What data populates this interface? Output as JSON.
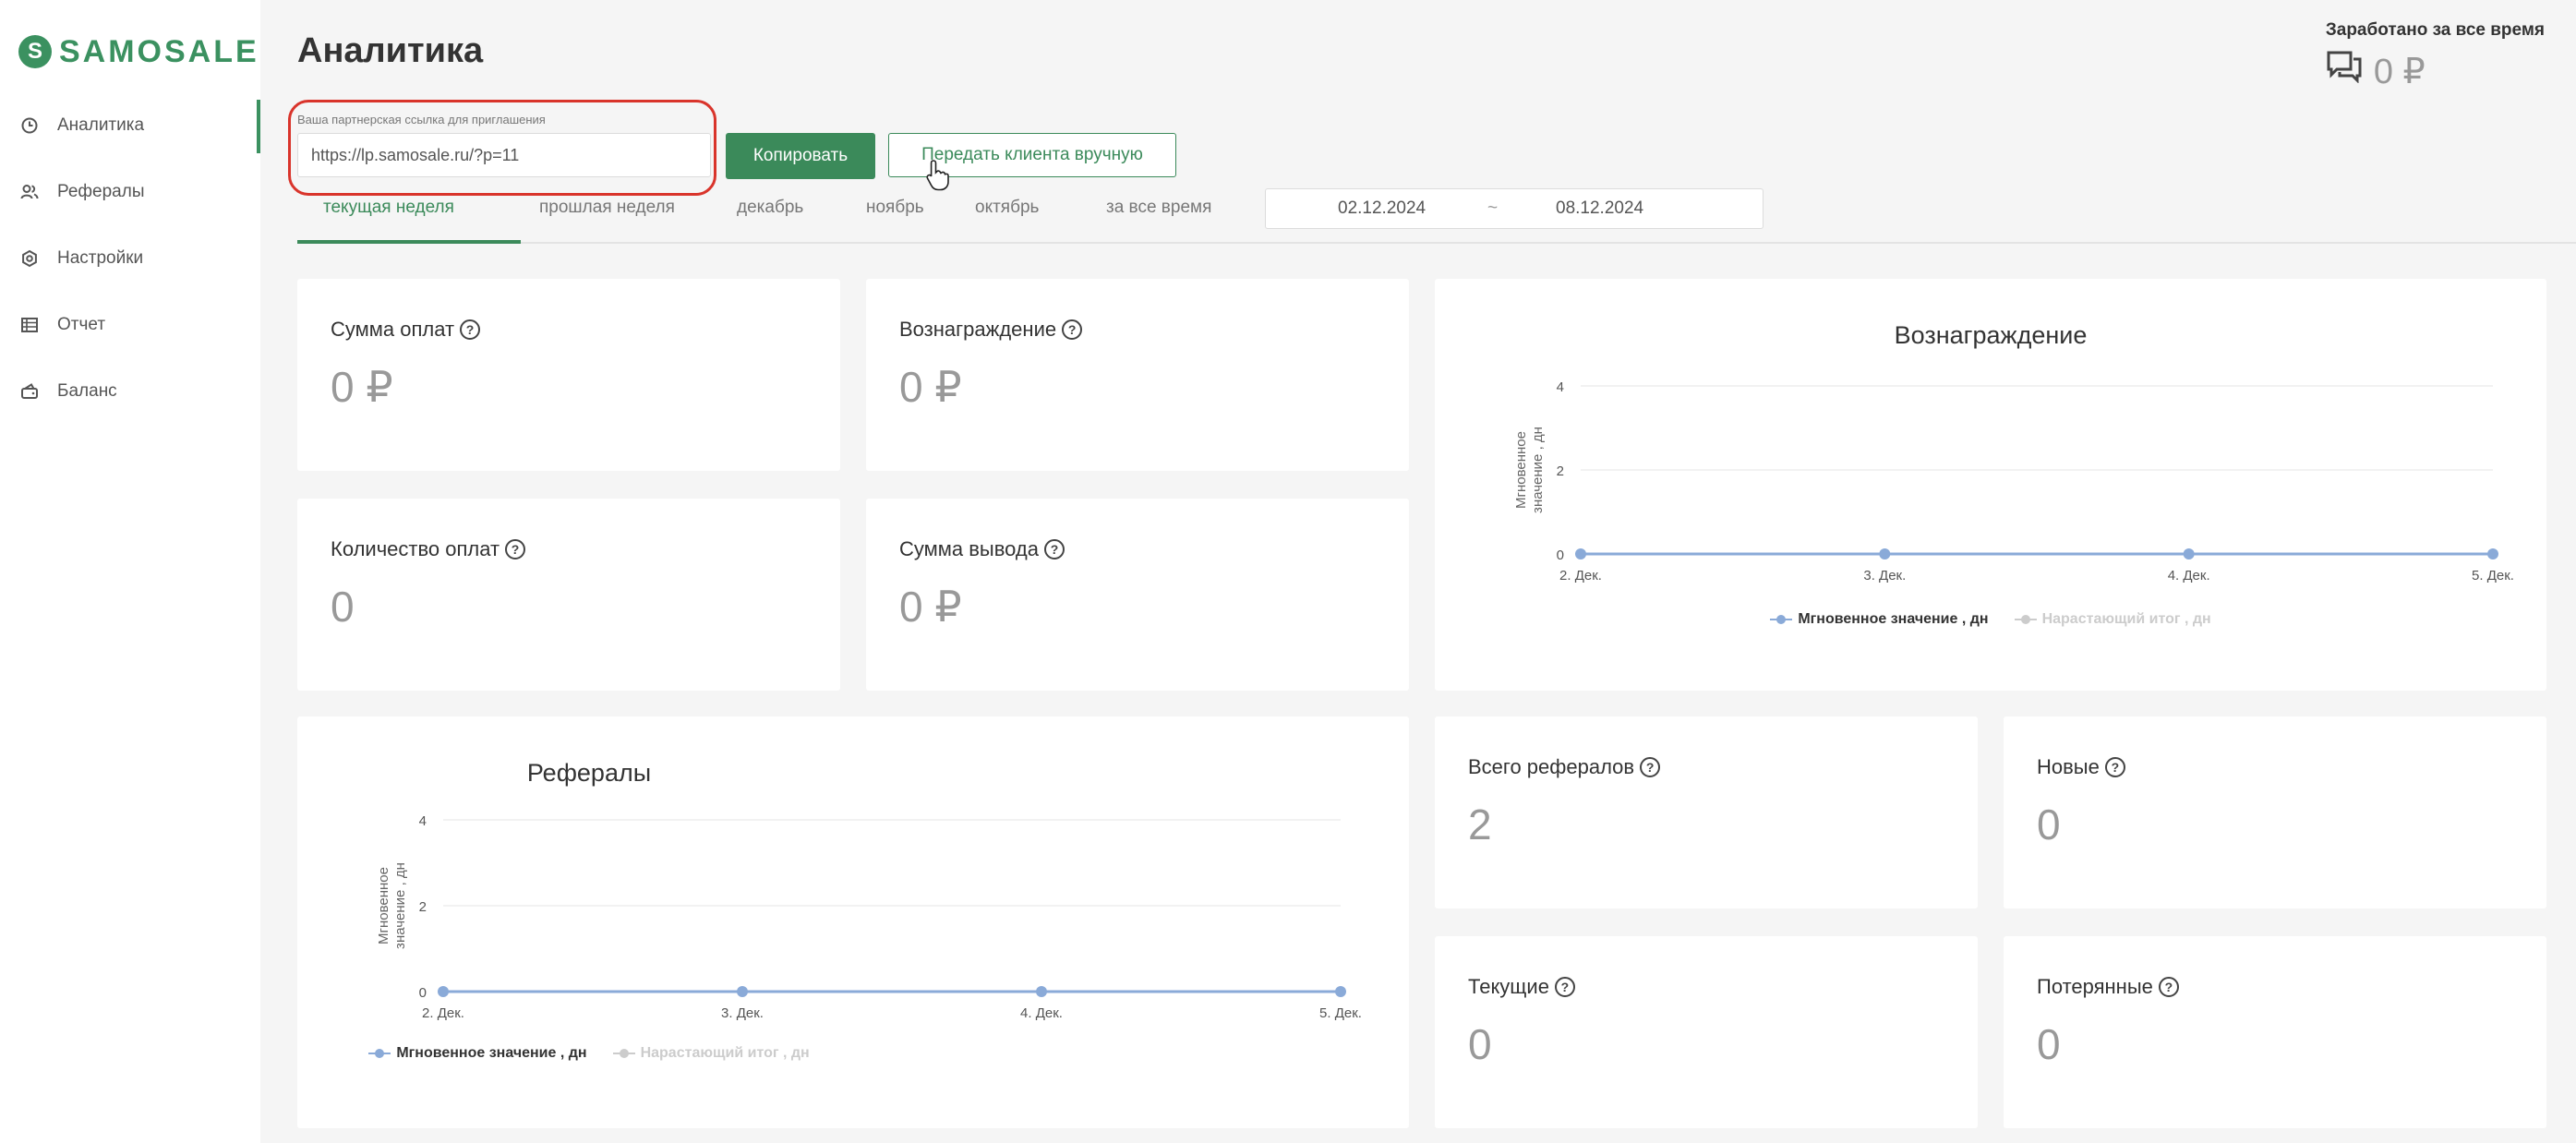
{
  "brand": {
    "logo_text": "SAMOSALE",
    "logo_letter": "S",
    "accent": "#3b9160",
    "alert": "#d9342b"
  },
  "sidebar": {
    "items": [
      {
        "label": "Аналитика",
        "icon": "clock-icon",
        "active": true
      },
      {
        "label": "Рефералы",
        "icon": "users-icon",
        "active": false
      },
      {
        "label": "Настройки",
        "icon": "gear-icon",
        "active": false
      },
      {
        "label": "Отчет",
        "icon": "table-icon",
        "active": false
      },
      {
        "label": "Баланс",
        "icon": "wallet-icon",
        "active": false
      }
    ]
  },
  "header": {
    "title": "Аналитика",
    "earned_label": "Заработано за все время",
    "earned_value": "0 ₽"
  },
  "referral": {
    "label": "Ваша партнерская ссылка для приглашения",
    "link": "https://lp.samosale.ru/?p=11",
    "copy_label": "Копировать",
    "manual_label": "Передать клиента вручную"
  },
  "tabs": [
    {
      "label": "текущая неделя",
      "active": true
    },
    {
      "label": "прошлая неделя",
      "active": false
    },
    {
      "label": "декабрь",
      "active": false
    },
    {
      "label": "ноябрь",
      "active": false
    },
    {
      "label": "октябрь",
      "active": false
    },
    {
      "label": "за все время",
      "active": false
    }
  ],
  "date_range": {
    "from": "02.12.2024",
    "separator": "~",
    "to": "08.12.2024"
  },
  "stats": {
    "payments_sum": {
      "title": "Сумма оплат",
      "value": "0 ₽"
    },
    "reward": {
      "title": "Вознаграждение",
      "value": "0 ₽"
    },
    "payments_count": {
      "title": "Количество оплат",
      "value": "0"
    },
    "withdraw_sum": {
      "title": "Сумма вывода",
      "value": "0 ₽"
    },
    "total_referrals": {
      "title": "Всего рефералов",
      "value": "2"
    },
    "new": {
      "title": "Новые",
      "value": "0"
    },
    "current": {
      "title": "Текущие",
      "value": "0"
    },
    "lost": {
      "title": "Потерянные",
      "value": "0"
    }
  },
  "chart_data": [
    {
      "type": "line",
      "title": "Вознаграждение",
      "ylabel": "Мгновенное значение , дн",
      "categories": [
        "2. Дек.",
        "3. Дек.",
        "4. Дек.",
        "5. Дек."
      ],
      "yticks": [
        "0",
        "2",
        "4"
      ],
      "ylim": [
        0,
        4
      ],
      "grid": true,
      "series": [
        {
          "name": "Мгновенное значение , дн",
          "values": [
            0,
            0,
            0,
            0
          ],
          "color": "#8aaad8"
        },
        {
          "name": "Нарастающий итог , дн",
          "values": [],
          "color": "#cccccc"
        }
      ],
      "legend": "bottom-center"
    },
    {
      "type": "line",
      "title": "Рефералы",
      "ylabel": "Мгновенное значение , дн",
      "categories": [
        "2. Дек.",
        "3. Дек.",
        "4. Дек.",
        "5. Дек."
      ],
      "yticks": [
        "0",
        "2",
        "4"
      ],
      "ylim": [
        0,
        4
      ],
      "grid": true,
      "series": [
        {
          "name": "Мгновенное значение , дн",
          "values": [
            0,
            0,
            0,
            0
          ],
          "color": "#8aaad8"
        },
        {
          "name": "Нарастающий итог , дн",
          "values": [],
          "color": "#cccccc"
        }
      ],
      "legend": "bottom-center"
    }
  ]
}
